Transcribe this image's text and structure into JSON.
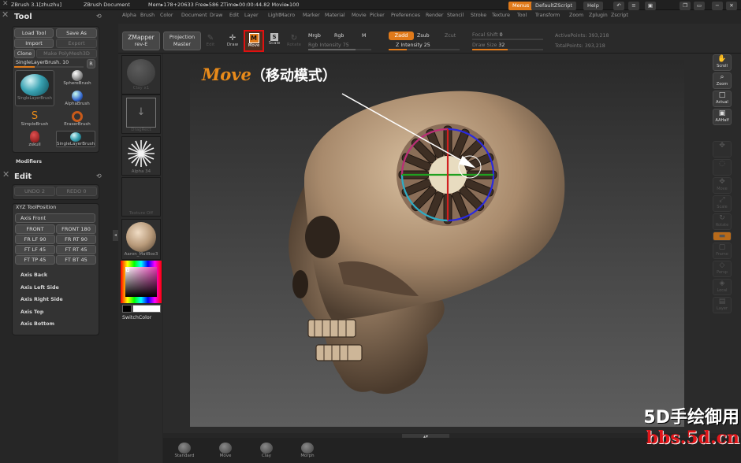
{
  "topbar": {
    "app": "ZBrush  3.1[zhuzhu]",
    "doc": "ZBrush Document",
    "status": "Mem▸178+20633 Free▸586 ZTime▸00:00:44.82 Movie▸100",
    "menus_btn": "Menus",
    "script_btn": "DefaultZScript",
    "help_btn": "Help",
    "win_icons": [
      "↶",
      "≡",
      "▣",
      "❐",
      "▭",
      "−",
      "✕"
    ]
  },
  "menubar": [
    "Alpha",
    "Brush",
    "Color",
    "Document",
    "Draw",
    "Edit",
    "Layer",
    "Light",
    "Macro",
    "Marker",
    "Material",
    "Movie",
    "Picker",
    "Preferences",
    "Render",
    "Stencil",
    "Stroke",
    "Texture",
    "Tool",
    "Transform",
    "Zoom",
    "Zplugin",
    "Zscript"
  ],
  "shelf": {
    "zmapper": "ZMapper",
    "zmapper2": "rev-E",
    "projection": "Projection",
    "projection2": "Master",
    "edit": "Edit",
    "draw": "Draw",
    "move": "Move",
    "scale": "Scale",
    "rotate": "Rotate",
    "mrgb": "Mrgb",
    "rgb": "Rgb",
    "m": "M",
    "rgb_intensity_label": "Rgb Intensity",
    "rgb_intensity": "75",
    "zadd": "Zadd",
    "zsub": "Zsub",
    "zcut": "Zcut",
    "z_intensity_label": "Z Intensity",
    "z_intensity": "25",
    "focal_shift_label": "Focal Shift",
    "focal_shift": "0",
    "draw_size_label": "Draw Size",
    "draw_size": "32",
    "active_points": "ActivePoints: 393,218",
    "total_points": "TotalPoints: 393,218"
  },
  "tool_panel": {
    "title": "Tool",
    "load": "Load Tool",
    "save": "Save As",
    "import": "Import",
    "export": "Export",
    "clone": "Clone",
    "make_poly": "Make PolyMesh3D",
    "current_brush": "SingleLayerBrush. 10",
    "r": "R",
    "brushes": [
      "SingleLayerBrush",
      "SphereBrush",
      "AlphaBrush",
      "SimpleBrush",
      "EraserBrush",
      "zskull",
      "SingleLayerBrush"
    ],
    "modifiers": "Modifiers"
  },
  "edit_panel": {
    "title": "Edit",
    "undo": "UNDO 2",
    "redo": "REDO 0",
    "xyz": "XYZ ToolPosition",
    "axis_front": "Axis Front",
    "buttons": [
      "FRONT",
      "FRONT 180",
      "FR LF 90",
      "FR RT 90",
      "FT LF 45",
      "FT RT 45",
      "FT TP 45",
      "FT BT 45"
    ],
    "axis_items": [
      "Axis Back",
      "Axis Left Side",
      "Axis Right Side",
      "Axis Top",
      "Axis Bottom"
    ]
  },
  "left_shelf": {
    "brush_label": "Clay x1",
    "stroke_label": "DragRect",
    "alpha_label": "Alpha 34",
    "texture_label": "Texture Off",
    "material_label": "Aaron_MatBox3",
    "switch_color": "SwitchColor"
  },
  "right_tools": [
    {
      "label": "Scroll",
      "glyph": "✋",
      "active": true
    },
    {
      "label": "Zoom",
      "glyph": "⌕",
      "active": true
    },
    {
      "label": "Actual",
      "glyph": "□",
      "active": true
    },
    {
      "label": "AAHalf",
      "glyph": "▣",
      "active": true
    },
    {
      "label": "",
      "glyph": "✥",
      "active": false
    },
    {
      "label": "",
      "glyph": "◌",
      "active": false
    },
    {
      "label": "Move",
      "glyph": "✥",
      "active": false
    },
    {
      "label": "Scale",
      "glyph": "⤢",
      "active": false
    },
    {
      "label": "Rotate",
      "glyph": "↻",
      "active": false
    },
    {
      "label": "",
      "glyph": "▬",
      "active": false
    },
    {
      "label": "Frame",
      "glyph": "▢",
      "active": false
    },
    {
      "label": "Persp",
      "glyph": "◇",
      "active": false
    },
    {
      "label": "Local",
      "glyph": "◈",
      "active": false
    },
    {
      "label": "Layer",
      "glyph": "▤",
      "active": false
    }
  ],
  "annotation": {
    "main": "Move",
    "cn": "（移动模式）"
  },
  "bottom_shelf": [
    "Standard",
    "Move",
    "Clay",
    "Morph"
  ],
  "watermark": {
    "line1": "5D手绘御用",
    "line2": "bbs.5d.cn"
  },
  "colors": {
    "accent": "#e07a1a",
    "highlight": "#e01010",
    "wm_red": "#e0161a"
  }
}
